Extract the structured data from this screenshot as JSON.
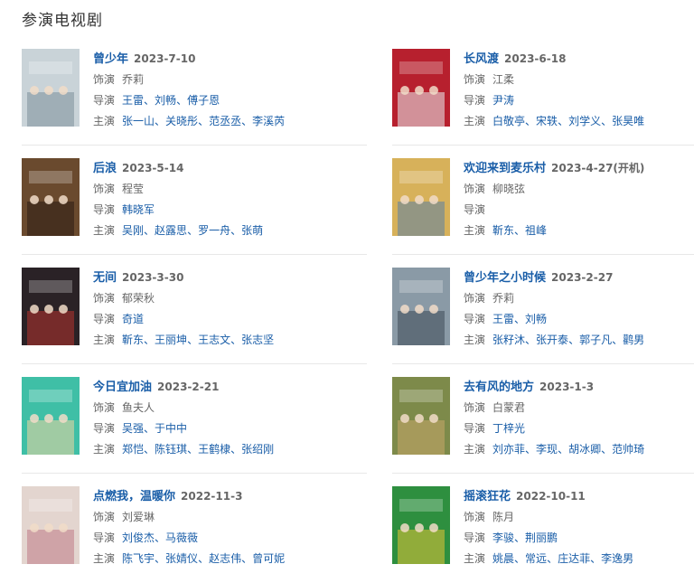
{
  "section_title": "参演电视剧",
  "labels": {
    "role": "饰演",
    "director": "导演",
    "cast": "主演"
  },
  "shows": [
    {
      "title": "曾少年",
      "date": "2023-7-10",
      "role": "乔莉",
      "directors": [
        "王雷",
        "刘畅",
        "傅子恩"
      ],
      "cast": [
        "张一山",
        "关晓彤",
        "范丞丞",
        "李溪芮"
      ],
      "poster_color": "#c9d3d8",
      "poster_accent": "#7b8f9b"
    },
    {
      "title": "长风渡",
      "date": "2023-6-18",
      "role": "江柔",
      "directors": [
        "尹涛"
      ],
      "cast": [
        "白敬亭",
        "宋轶",
        "刘学义",
        "张昊唯"
      ],
      "poster_color": "#b7202e",
      "poster_accent": "#e9eef2"
    },
    {
      "title": "后浪",
      "date": "2023-5-14",
      "role": "程莹",
      "directors": [
        "韩晓军"
      ],
      "cast": [
        "吴刚",
        "赵露思",
        "罗一舟",
        "张萌"
      ],
      "poster_color": "#6a4a2e",
      "poster_accent": "#2a1c14"
    },
    {
      "title": "欢迎来到麦乐村",
      "date": "2023-4-27(开机)",
      "role": "柳晓弦",
      "directors": [],
      "cast": [
        "靳东",
        "祖峰"
      ],
      "poster_color": "#d7b15a",
      "poster_accent": "#5b7fa6"
    },
    {
      "title": "无间",
      "date": "2023-3-30",
      "role": "郁荣秋",
      "directors": [
        "奇道"
      ],
      "cast": [
        "靳东",
        "王丽坤",
        "王志文",
        "张志坚"
      ],
      "poster_color": "#2a2226",
      "poster_accent": "#b5332d"
    },
    {
      "title": "曾少年之小时候",
      "date": "2023-2-27",
      "role": "乔莉",
      "directors": [
        "王雷",
        "刘畅"
      ],
      "cast": [
        "张籽沐",
        "张开泰",
        "郭子凡",
        "鹳男"
      ],
      "poster_color": "#8a9aa6",
      "poster_accent": "#3e4b56"
    },
    {
      "title": "今日宜加油",
      "date": "2023-2-21",
      "role": "鱼夫人",
      "directors": [
        "吴强",
        "于中中"
      ],
      "cast": [
        "郑恺",
        "陈钰琪",
        "王鹤棣",
        "张绍刚"
      ],
      "poster_color": "#3fbfa6",
      "poster_accent": "#f0d6a0"
    },
    {
      "title": "去有风的地方",
      "date": "2023-1-3",
      "role": "白蒙君",
      "directors": [
        "丁梓光"
      ],
      "cast": [
        "刘亦菲",
        "李现",
        "胡冰卿",
        "范帅琦"
      ],
      "poster_color": "#7d8a4a",
      "poster_accent": "#c8a86a"
    },
    {
      "title": "点燃我，温暖你",
      "date": "2022-11-3",
      "role": "刘爱琳",
      "directors": [
        "刘俊杰",
        "马薇薇"
      ],
      "cast": [
        "陈飞宇",
        "张婧仪",
        "赵志伟",
        "曾可妮"
      ],
      "poster_color": "#e3d5cf",
      "poster_accent": "#c07a86"
    },
    {
      "title": "摇滚狂花",
      "date": "2022-10-11",
      "role": "陈月",
      "directors": [
        "李骏",
        "荆丽鹏"
      ],
      "cast": [
        "姚晨",
        "常远",
        "庄达菲",
        "李逸男"
      ],
      "poster_color": "#2e8f3f",
      "poster_accent": "#e4c437"
    }
  ]
}
